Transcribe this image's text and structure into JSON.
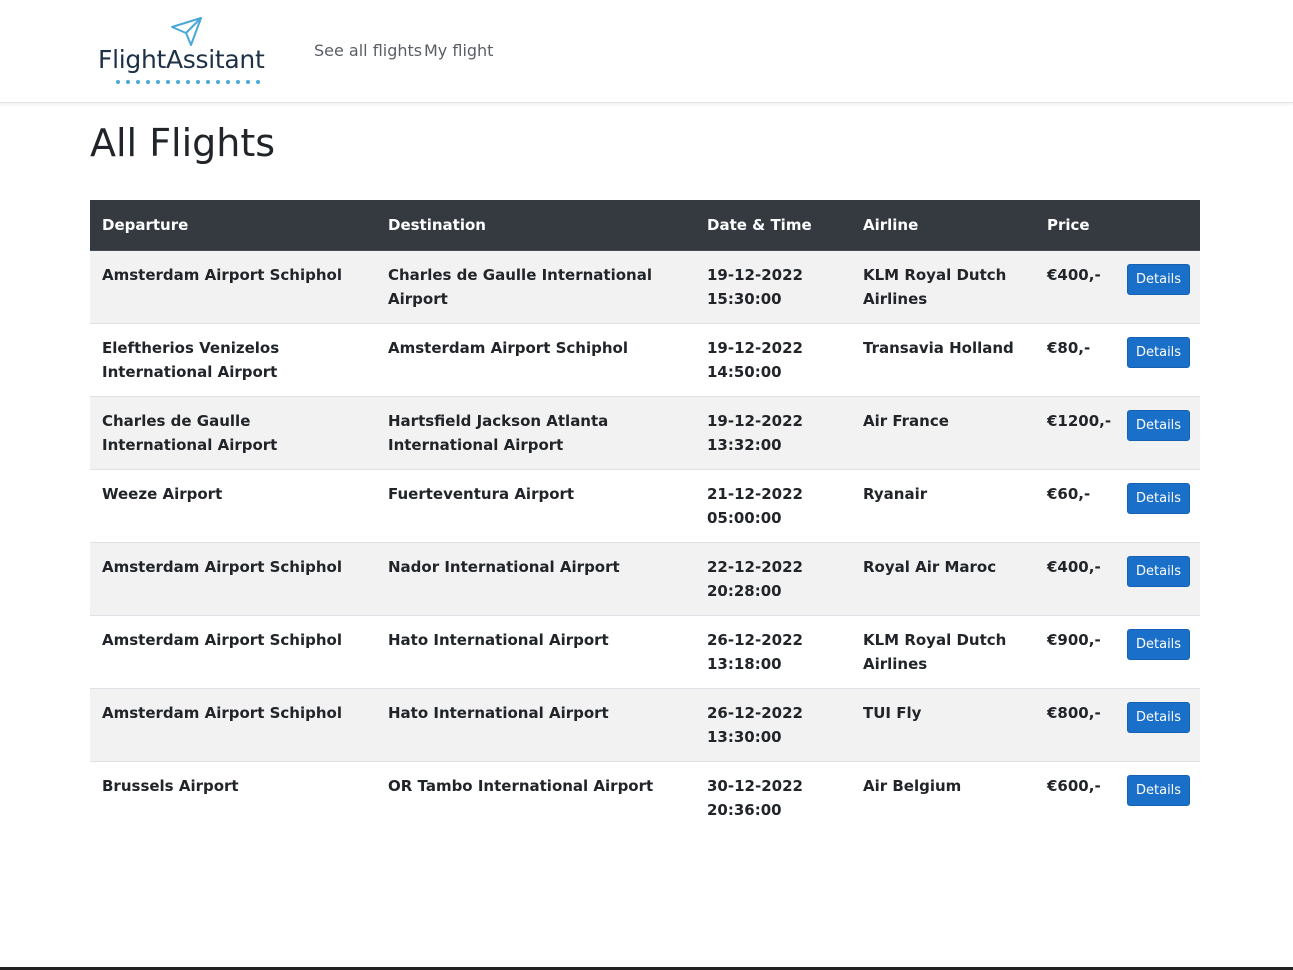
{
  "brand": {
    "name": "FlightAssitant",
    "accent": "#4aa8d8",
    "text_color": "#1f3147",
    "icon": "paper-plane-icon"
  },
  "nav": {
    "links": [
      {
        "label": "See all flights"
      },
      {
        "label": "My flight"
      }
    ]
  },
  "page": {
    "title": "All Flights"
  },
  "table": {
    "header_bg": "#343a40",
    "columns": [
      "Departure",
      "Destination",
      "Date & Time",
      "Airline",
      "Price",
      ""
    ],
    "button_label": "Details",
    "button_color": "#1a6fc9",
    "rows": [
      {
        "departure": "Amsterdam Airport Schiphol",
        "destination": "Charles de Gaulle International Airport",
        "date": "19-12-2022",
        "time": "15:30:00",
        "airline": "KLM Royal Dutch Airlines",
        "price": "€400,-"
      },
      {
        "departure": "Eleftherios Venizelos International Airport",
        "destination": "Amsterdam Airport Schiphol",
        "date": "19-12-2022",
        "time": "14:50:00",
        "airline": "Transavia Holland",
        "price": "€80,-"
      },
      {
        "departure": "Charles de Gaulle International Airport",
        "destination": "Hartsfield Jackson Atlanta International Airport",
        "date": "19-12-2022",
        "time": "13:32:00",
        "airline": "Air France",
        "price": "€1200,-"
      },
      {
        "departure": "Weeze Airport",
        "destination": "Fuerteventura Airport",
        "date": "21-12-2022",
        "time": "05:00:00",
        "airline": "Ryanair",
        "price": "€60,-"
      },
      {
        "departure": "Amsterdam Airport Schiphol",
        "destination": "Nador International Airport",
        "date": "22-12-2022",
        "time": "20:28:00",
        "airline": "Royal Air Maroc",
        "price": "€400,-"
      },
      {
        "departure": "Amsterdam Airport Schiphol",
        "destination": "Hato International Airport",
        "date": "26-12-2022",
        "time": "13:18:00",
        "airline": "KLM Royal Dutch Airlines",
        "price": "€900,-"
      },
      {
        "departure": "Amsterdam Airport Schiphol",
        "destination": "Hato International Airport",
        "date": "26-12-2022",
        "time": "13:30:00",
        "airline": "TUI Fly",
        "price": "€800,-"
      },
      {
        "departure": "Brussels Airport",
        "destination": "OR Tambo International Airport",
        "date": "30-12-2022",
        "time": "20:36:00",
        "airline": "Air Belgium",
        "price": "€600,-"
      }
    ]
  }
}
